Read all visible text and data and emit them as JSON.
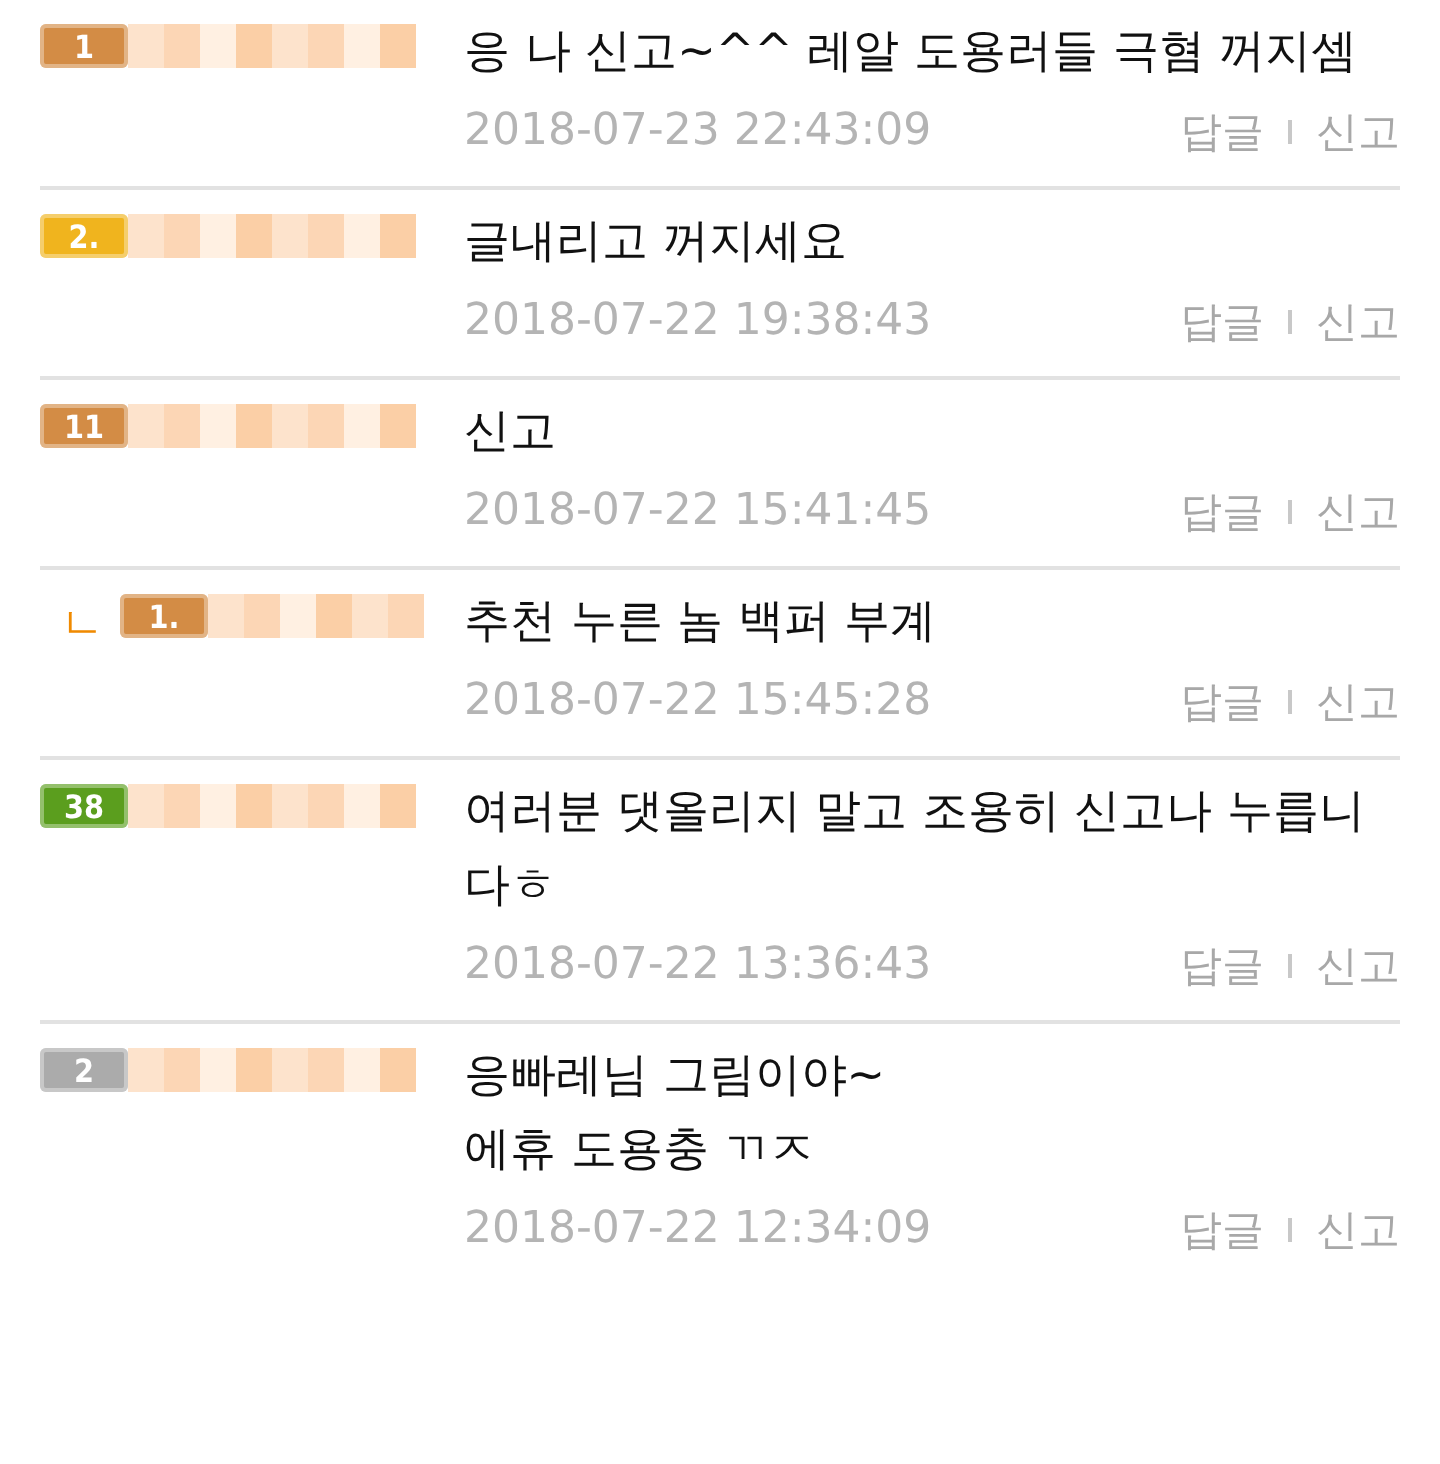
{
  "comments": [
    {
      "kind": "comment",
      "badge": "1",
      "color": "#d38c45",
      "lines": [
        "응 나 신고~^^ 레알 도용러들 극혐 꺼지셈"
      ],
      "date": "2018-07-23 22:43:09",
      "actions": [
        "답글",
        "신고"
      ]
    },
    {
      "kind": "comment",
      "badge": "2.",
      "color": "#f0b41e",
      "lines": [
        "글내리고 꺼지세요"
      ],
      "date": "2018-07-22 19:38:43",
      "actions": [
        "답글",
        "신고"
      ]
    },
    {
      "kind": "comment",
      "badge": "11",
      "color": "#d38c45",
      "lines": [
        "신고"
      ],
      "date": "2018-07-22 15:41:45",
      "actions": [
        "답글",
        "신고"
      ]
    },
    {
      "kind": "reply",
      "marker": "ㄴ",
      "badge": "1.",
      "color": "#d38c45",
      "lines": [
        "추천 누른 놈 백퍼 부계"
      ],
      "date": "2018-07-22 15:45:28",
      "actions": [
        "답글",
        "신고"
      ]
    },
    {
      "kind": "comment",
      "badge": "38",
      "color": "#5b9e1e",
      "lines": [
        "여러분 댓올리지 말고 조용히 신고나 누릅니",
        "다ㅎ"
      ],
      "date": "2018-07-22 13:36:43",
      "actions": [
        "답글",
        "신고"
      ]
    },
    {
      "kind": "comment",
      "badge": "2",
      "color": "#ababab",
      "lines": [
        "응빠레님 그림이야~",
        "에휴 도용충 ㄲㅈ"
      ],
      "date": "2018-07-22 12:34:09",
      "actions": [
        "답글",
        "신고"
      ]
    }
  ]
}
